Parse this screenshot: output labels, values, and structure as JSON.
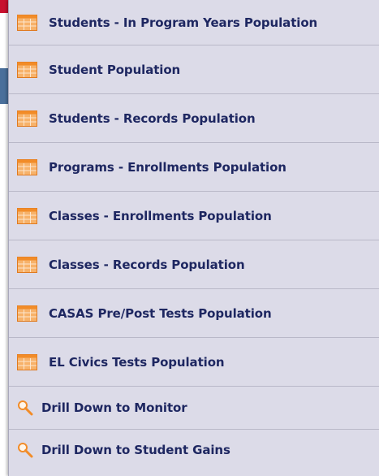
{
  "menu": {
    "items": [
      {
        "label": "Students - In Program Years Population",
        "icon": "table-icon"
      },
      {
        "label": "Student Population",
        "icon": "table-icon"
      },
      {
        "label": "Students - Records Population",
        "icon": "table-icon"
      },
      {
        "label": "Programs - Enrollments Population",
        "icon": "table-icon"
      },
      {
        "label": "Classes - Enrollments Population",
        "icon": "table-icon"
      },
      {
        "label": "Classes - Records Population",
        "icon": "table-icon"
      },
      {
        "label": "CASAS Pre/Post Tests Population",
        "icon": "table-icon"
      },
      {
        "label": "EL Civics Tests Population",
        "icon": "table-icon"
      },
      {
        "label": "Drill Down to Monitor",
        "icon": "search-icon"
      },
      {
        "label": "Drill Down to Student Gains",
        "icon": "search-icon"
      }
    ]
  },
  "colors": {
    "menu_background": "#dcdbe8",
    "label_text": "#1e2761",
    "table_icon": "#f28c28",
    "search_icon": "#f28c28",
    "background_red": "#c8102e",
    "background_blue": "#4a6f9b"
  }
}
